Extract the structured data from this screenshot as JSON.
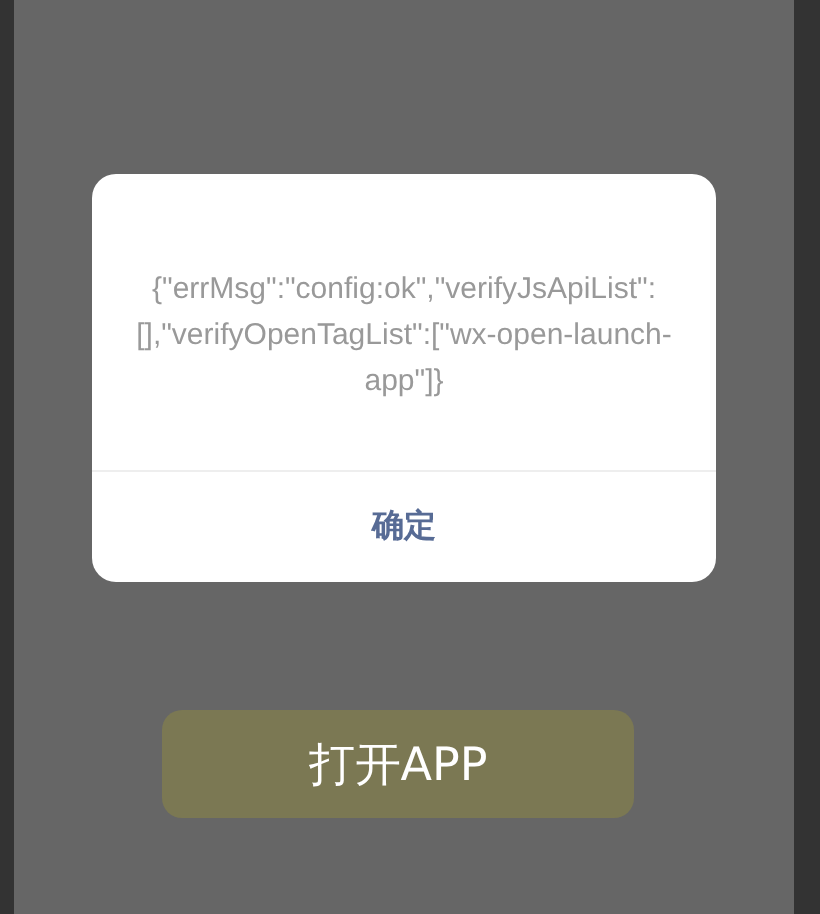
{
  "dialog": {
    "message": "{\"errMsg\":\"config:ok\",\"verifyJsApiList\":[],\"verifyOpenTagList\":[\"wx-open-launch-app\"]}",
    "confirm_button": "确定"
  },
  "open_app_button": "打开APP"
}
